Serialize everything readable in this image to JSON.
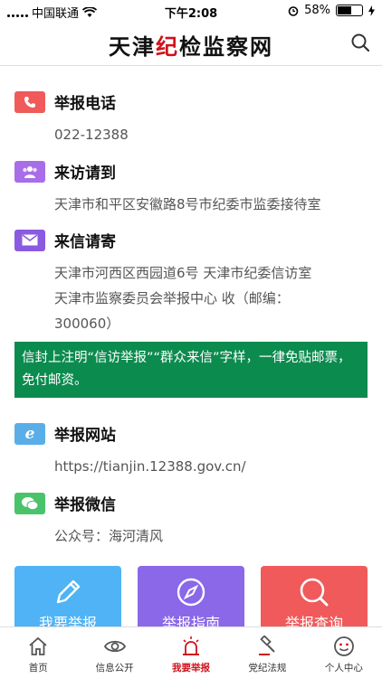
{
  "status": {
    "carrier": "中国联通",
    "time": "下午2:08",
    "battery": "58%",
    "battery_level": 0.58
  },
  "header": {
    "title_part1": "天津",
    "title_red": "纪",
    "title_part2": "检监察网"
  },
  "sections": [
    {
      "title": "举报电话",
      "lines": [
        "022-12388"
      ],
      "color": "#f05a5a",
      "icon": "phone-icon"
    },
    {
      "title": "来访请到",
      "lines": [
        "天津市和平区安徽路8号市纪委市监委接待室"
      ],
      "color": "#a86de8",
      "icon": "people-icon"
    },
    {
      "title": "来信请寄",
      "lines": [
        "天津市河西区西园道6号 天津市纪委信访室",
        "天津市监察委员会举报中心 收（邮编：",
        "300060）"
      ],
      "color": "#8a5be0",
      "icon": "envelope-icon"
    },
    {
      "title": "举报网站",
      "lines": [
        "https://tianjin.12388.gov.cn/"
      ],
      "color": "#5aaee8",
      "icon": "browser-icon"
    },
    {
      "title": "举报微信",
      "lines": [
        "公众号：海河清风"
      ],
      "color": "#4ac36b",
      "icon": "wechat-icon"
    }
  ],
  "notice": "信封上注明“信访举报”“群众来信”字样，一律免贴邮票，免付邮资。",
  "tiles": [
    {
      "label": "我要举报",
      "color": "#4fb3f5",
      "icon": "pencil-icon"
    },
    {
      "label": "举报指南",
      "color": "#8a68e8",
      "icon": "compass-icon"
    },
    {
      "label": "举报查询",
      "color": "#f05a5a",
      "icon": "search-icon"
    }
  ],
  "tabs": [
    {
      "label": "首页",
      "icon": "home-icon"
    },
    {
      "label": "信息公开",
      "icon": "eye-icon"
    },
    {
      "label": "我要举报",
      "icon": "alarm-icon",
      "active": true
    },
    {
      "label": "党纪法规",
      "icon": "gavel-icon"
    },
    {
      "label": "个人中心",
      "icon": "smiley-icon"
    }
  ]
}
